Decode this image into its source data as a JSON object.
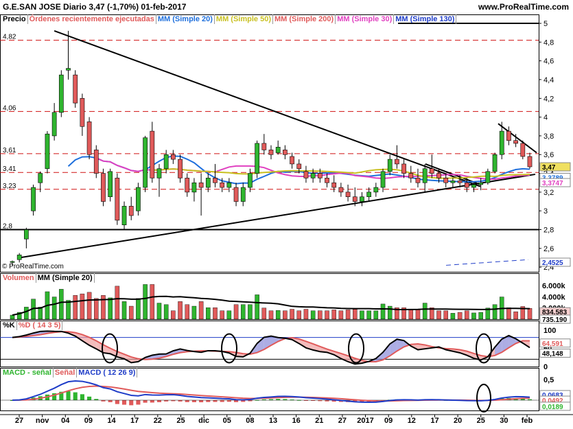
{
  "header": {
    "left_title": "G.E.SAN JOSE   Diario   3,47 (-1,70%)   01-feb-2017",
    "right_title": "www.ProRealTime.com",
    "copyright": "© ProRealTime.com"
  },
  "legend_price": [
    "Precio",
    "Órdenes recientemente ejecutadas",
    "MM (Simple 20)",
    "MM (Simple 50)",
    "MM (Simple 200)",
    "MM (Simple 30)",
    "MM (Simple 130)"
  ],
  "legend_volume": [
    "Volumen",
    "MM (Simple 20)"
  ],
  "legend_stoch": [
    "%K",
    "%D ( 14 3 5)"
  ],
  "legend_macd": [
    "MACD - señal",
    "Señal",
    "MACD ( 12 26 9)"
  ],
  "colors": {
    "up": "#2fb52f",
    "down": "#e05a5a",
    "ma20": "#1e6fdc",
    "ma50": "#c8c020",
    "ma200": "#1e3cc8",
    "ma30": "#e040c0",
    "black": "#000000",
    "dash": "#d01010"
  },
  "price_levels_left": [
    "4,82",
    "4,06",
    "3,61",
    "3,41",
    "3,23",
    "2,8"
  ],
  "price_axis": [
    "5",
    "4,8",
    "4,6",
    "4,4",
    "4,2",
    "4",
    "3,8",
    "3,6",
    "3,4",
    "3,2",
    "3",
    "2,8",
    "2,6",
    "2,4"
  ],
  "price_flags": {
    "last": "3,47",
    "ma30": "3,3747",
    "ma20": "3,3789",
    "ma200": "2,4525"
  },
  "volume_axis": [
    "6.000k",
    "4.000k",
    "2.000k"
  ],
  "volume_flags": {
    "ma": "834.583",
    "last": "735.190"
  },
  "stoch_axis": [
    "100",
    "50",
    "0"
  ],
  "stoch_flags": {
    "d": "64,591",
    "k": "48,148"
  },
  "macd_axis": [
    "0,5"
  ],
  "macd_flags": {
    "macd": "0,0683",
    "signal": "0,0492",
    "hist": "0,0189"
  },
  "x_labels": [
    "27",
    "nov",
    "04",
    "09",
    "14",
    "17",
    "22",
    "25",
    "dic",
    "05",
    "08",
    "13",
    "16",
    "21",
    "27",
    "2017",
    "09",
    "12",
    "17",
    "20",
    "25",
    "30",
    "feb"
  ],
  "chart_data": {
    "type": "candlestick",
    "x_labels": [
      "27",
      "nov",
      "04",
      "09",
      "14",
      "17",
      "22",
      "25",
      "dic",
      "05",
      "08",
      "13",
      "16",
      "21",
      "27",
      "2017",
      "09",
      "12",
      "17",
      "20",
      "25",
      "30",
      "feb"
    ],
    "candles": [
      [
        2.45,
        2.47,
        2.42,
        2.46
      ],
      [
        2.48,
        2.55,
        2.45,
        2.53
      ],
      [
        2.7,
        2.82,
        2.6,
        2.8
      ],
      [
        3.0,
        3.28,
        2.95,
        3.25
      ],
      [
        3.3,
        3.42,
        3.2,
        3.4
      ],
      [
        3.45,
        3.85,
        3.4,
        3.82
      ],
      [
        3.8,
        4.15,
        3.75,
        4.05
      ],
      [
        4.05,
        4.5,
        4.0,
        4.45
      ],
      [
        4.5,
        4.92,
        4.4,
        4.52
      ],
      [
        4.45,
        4.5,
        4.1,
        4.15
      ],
      [
        4.2,
        4.25,
        3.8,
        3.9
      ],
      [
        3.95,
        4.0,
        3.55,
        3.6
      ],
      [
        3.65,
        3.7,
        3.35,
        3.4
      ],
      [
        3.4,
        3.45,
        3.05,
        3.1
      ],
      [
        3.15,
        3.45,
        3.1,
        3.42
      ],
      [
        3.35,
        3.4,
        2.85,
        2.9
      ],
      [
        2.85,
        3.1,
        2.8,
        3.05
      ],
      [
        3.05,
        3.15,
        2.9,
        2.95
      ],
      [
        3.0,
        3.3,
        2.95,
        3.25
      ],
      [
        3.25,
        3.8,
        3.2,
        3.78
      ],
      [
        3.85,
        3.95,
        3.3,
        3.35
      ],
      [
        3.35,
        3.5,
        3.15,
        3.45
      ],
      [
        3.45,
        3.65,
        3.4,
        3.6
      ],
      [
        3.6,
        3.65,
        3.5,
        3.55
      ],
      [
        3.55,
        3.6,
        3.3,
        3.35
      ],
      [
        3.35,
        3.4,
        3.15,
        3.2
      ],
      [
        3.2,
        3.35,
        3.1,
        3.3
      ],
      [
        3.3,
        3.4,
        2.95,
        3.25
      ],
      [
        3.25,
        3.4,
        3.2,
        3.35
      ],
      [
        3.35,
        3.5,
        3.25,
        3.3
      ],
      [
        3.3,
        3.35,
        3.2,
        3.25
      ],
      [
        3.25,
        3.35,
        3.2,
        3.3
      ],
      [
        3.25,
        3.3,
        3.05,
        3.1
      ],
      [
        3.1,
        3.3,
        3.05,
        3.25
      ],
      [
        3.25,
        3.45,
        3.2,
        3.4
      ],
      [
        3.4,
        3.75,
        3.35,
        3.72
      ],
      [
        3.72,
        3.82,
        3.6,
        3.65
      ],
      [
        3.65,
        3.7,
        3.55,
        3.6
      ],
      [
        3.62,
        3.75,
        3.6,
        3.68
      ],
      [
        3.65,
        3.7,
        3.55,
        3.6
      ],
      [
        3.58,
        3.62,
        3.45,
        3.5
      ],
      [
        3.5,
        3.55,
        3.4,
        3.45
      ],
      [
        3.42,
        3.48,
        3.3,
        3.35
      ],
      [
        3.35,
        3.45,
        3.3,
        3.4
      ],
      [
        3.4,
        3.45,
        3.3,
        3.35
      ],
      [
        3.35,
        3.4,
        3.25,
        3.3
      ],
      [
        3.3,
        3.38,
        3.2,
        3.25
      ],
      [
        3.25,
        3.3,
        3.15,
        3.2
      ],
      [
        3.2,
        3.28,
        3.1,
        3.15
      ],
      [
        3.15,
        3.25,
        3.05,
        3.1
      ],
      [
        3.1,
        3.2,
        3.05,
        3.15
      ],
      [
        3.15,
        3.25,
        3.1,
        3.2
      ],
      [
        3.2,
        3.3,
        3.15,
        3.25
      ],
      [
        3.25,
        3.45,
        3.2,
        3.42
      ],
      [
        3.42,
        3.6,
        3.38,
        3.55
      ],
      [
        3.55,
        3.7,
        3.45,
        3.5
      ],
      [
        3.5,
        3.55,
        3.35,
        3.4
      ],
      [
        3.4,
        3.48,
        3.3,
        3.35
      ],
      [
        3.35,
        3.45,
        3.25,
        3.3
      ],
      [
        3.3,
        3.5,
        3.2,
        3.45
      ],
      [
        3.45,
        3.6,
        3.35,
        3.4
      ],
      [
        3.4,
        3.45,
        3.3,
        3.35
      ],
      [
        3.35,
        3.4,
        3.25,
        3.3
      ],
      [
        3.3,
        3.35,
        3.25,
        3.32
      ],
      [
        3.32,
        3.38,
        3.25,
        3.3
      ],
      [
        3.3,
        3.35,
        3.2,
        3.25
      ],
      [
        3.25,
        3.3,
        3.2,
        3.28
      ],
      [
        3.28,
        3.35,
        3.22,
        3.3
      ],
      [
        3.3,
        3.45,
        3.28,
        3.42
      ],
      [
        3.42,
        3.62,
        3.4,
        3.6
      ],
      [
        3.6,
        3.95,
        3.55,
        3.85
      ],
      [
        3.85,
        3.9,
        3.7,
        3.75
      ],
      [
        3.75,
        3.82,
        3.68,
        3.72
      ],
      [
        3.72,
        3.75,
        3.55,
        3.58
      ],
      [
        3.58,
        3.62,
        3.45,
        3.47
      ]
    ],
    "price_ylim": [
      2.35,
      5.0
    ],
    "volume_ylim": [
      0,
      6500000
    ],
    "stoch_ylim": [
      0,
      100
    ],
    "macd_ylim": [
      -0.25,
      0.55
    ]
  }
}
